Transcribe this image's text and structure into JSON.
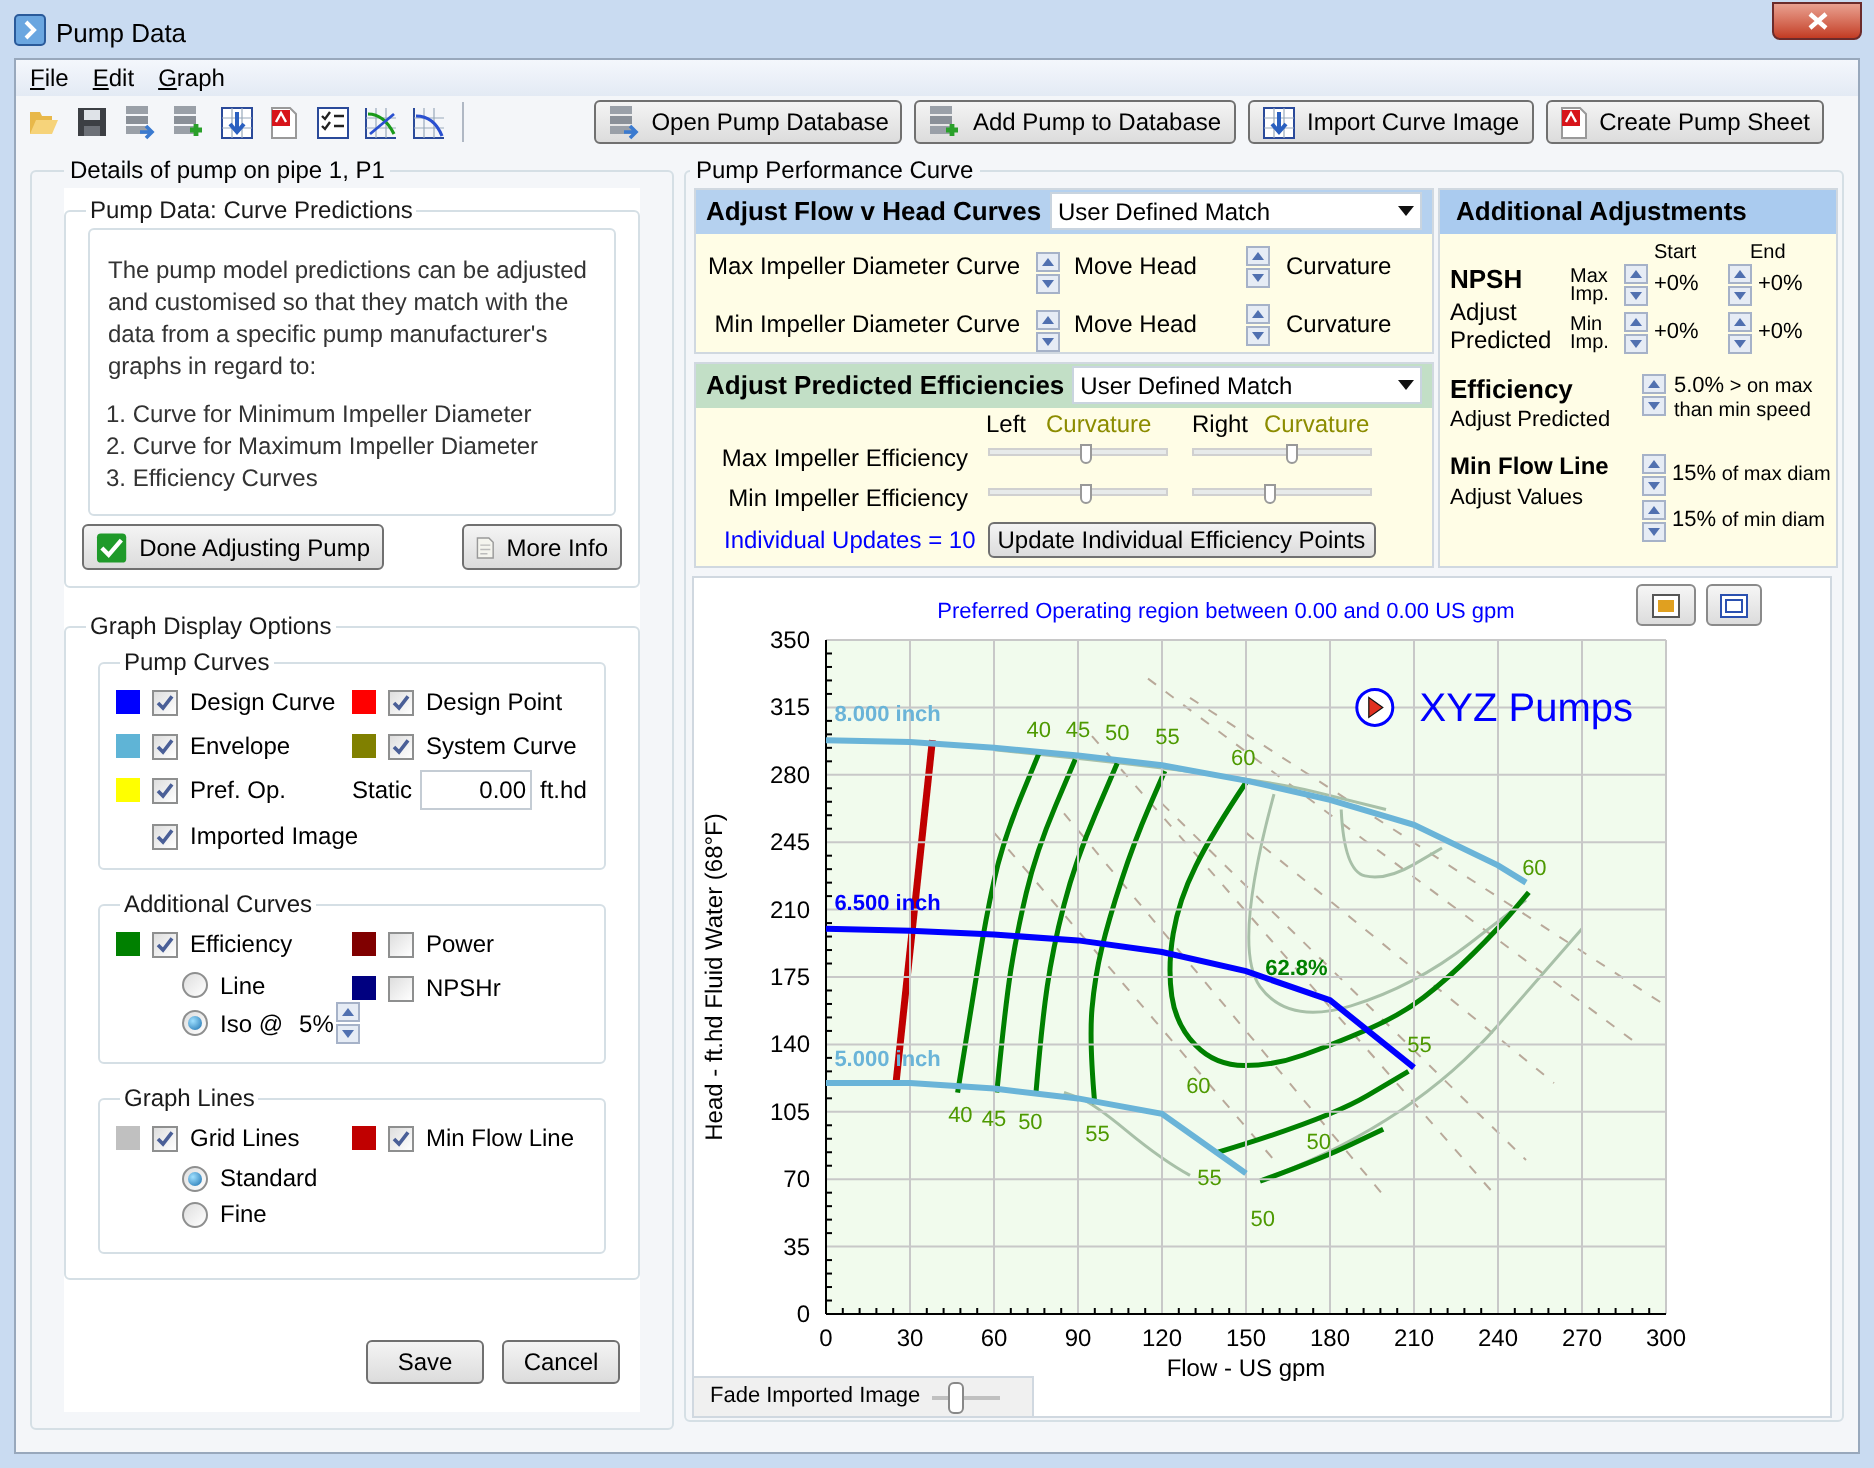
{
  "window": {
    "title": "Pump Data"
  },
  "menu": [
    {
      "label": "File"
    },
    {
      "label": "Edit"
    },
    {
      "label": "Graph"
    }
  ],
  "toolbar_buttons": [
    "Open Pump Database",
    "Add Pump to Database",
    "Import Curve Image",
    "Create Pump Sheet"
  ],
  "details": {
    "title": "Details of pump on pipe 1, P1",
    "predictions": {
      "title": "Pump Data: Curve Predictions",
      "intro": "The pump model predictions can be adjusted and customised so that they match with the data from a specific pump manufacturer's graphs in regard to:",
      "items": [
        "1. Curve for Minimum Impeller Diameter",
        "2. Curve for Maximum Impeller Diameter",
        "3. Efficiency Curves"
      ],
      "buttons": [
        "Done Adjusting Pump",
        "More Info"
      ]
    },
    "graph_options": {
      "title": "Graph Display Options",
      "pump_curves": {
        "title": "Pump Curves",
        "items": [
          {
            "label": "Design Curve",
            "color": "#0000ff",
            "checked": true
          },
          {
            "label": "Design Point",
            "color": "#ff0000",
            "checked": true
          },
          {
            "label": "Envelope",
            "color": "#5fb4d6",
            "checked": true
          },
          {
            "label": "System Curve",
            "color": "#808000",
            "checked": true
          },
          {
            "label": "Pref. Op.",
            "color": "#ffff00",
            "checked": true
          }
        ],
        "static": {
          "label": "Static",
          "value": "0.00",
          "unit": "ft.hd"
        },
        "imported_image": {
          "label": "Imported Image",
          "checked": true
        }
      },
      "additional_curves": {
        "title": "Additional Curves",
        "items": [
          {
            "label": "Efficiency",
            "color": "#008000",
            "checked": true
          },
          {
            "label": "Power",
            "color": "#800000",
            "checked": false
          },
          {
            "label": "NPSHr",
            "color": "#000080",
            "checked": false
          }
        ],
        "modes": [
          {
            "label": "Line",
            "selected": false
          },
          {
            "label": "Iso @",
            "selected": true
          }
        ],
        "iso_step": "5%"
      },
      "graph_lines": {
        "title": "Graph Lines",
        "items": [
          {
            "label": "Grid Lines",
            "color": "#c0c0c0",
            "checked": true
          },
          {
            "label": "Min Flow Line",
            "color": "#c00000",
            "checked": true
          }
        ],
        "styles": [
          {
            "label": "Standard",
            "selected": true
          },
          {
            "label": "Fine",
            "selected": false
          }
        ]
      }
    },
    "buttons": [
      "Save",
      "Cancel"
    ]
  },
  "performance": {
    "title": "Pump Performance Curve",
    "flow_head": {
      "title": "Adjust Flow v Head Curves",
      "mode": "User Defined Match",
      "rows": [
        {
          "label": "Max Impeller Diameter Curve",
          "controls": [
            "Move Head",
            "Curvature"
          ]
        },
        {
          "label": "Min Impeller Diameter Curve",
          "controls": [
            "Move Head",
            "Curvature"
          ]
        }
      ]
    },
    "efficiencies": {
      "title": "Adjust Predicted Efficiencies",
      "mode": "User Defined Match",
      "left_label": "Left",
      "left_curvature": "Curvature",
      "right_label": "Right",
      "right_curvature": "Curvature",
      "rows": [
        {
          "label": "Max Impeller Efficiency",
          "left": {
            "level": 0.54
          },
          "right": {
            "level": 0.56
          }
        },
        {
          "label": "Min Impeller Efficiency",
          "left": {
            "level": 0.54
          },
          "right": {
            "level": 0.43
          }
        }
      ],
      "updates": "Individual Updates = 10",
      "update_button": "Update Individual Efficiency Points"
    },
    "additional": {
      "title": "Additional Adjustments",
      "npsh": {
        "title": "NPSH",
        "subtitle": "Adjust Predicted",
        "start": "Start",
        "end": "End",
        "rows": [
          {
            "label": "Max Imp.",
            "start": "+0%",
            "end": "+0%"
          },
          {
            "label": "Min Imp.",
            "start": "+0%",
            "end": "+0%"
          }
        ]
      },
      "efficiency": {
        "title": "Efficiency",
        "subtitle": "Adjust Predicted",
        "value": "5.0%",
        "note": "> on max than min speed"
      },
      "min_flow": {
        "title": "Min Flow Line",
        "subtitle": "Adjust Values",
        "rows": [
          {
            "value": "15%",
            "note": "of max diam"
          },
          {
            "value": "15%",
            "note": "of min diam"
          }
        ]
      }
    },
    "graph": {
      "caption": "Preferred Operating region between 0.00 and 0.00 US gpm",
      "logo": "XYZ Pumps",
      "efficiency_labels": [
        "40",
        "45",
        "50",
        "55",
        "60",
        "60",
        "62.8%",
        "60",
        "55",
        "40",
        "45",
        "50",
        "55",
        "50",
        "55",
        "50"
      ],
      "chart_data": {
        "type": "line",
        "xlabel": "Flow - US gpm",
        "ylabel": "Head - ft.hd Fluid Water (68°F)",
        "x": [
          0,
          30,
          60,
          90,
          120,
          150,
          180,
          210,
          240,
          250
        ],
        "series": [
          {
            "name": "8.000 inch",
            "color": "#6ab4d8",
            "values": [
              298,
              297,
              294,
              290,
              285,
              277,
              267,
              254,
              233,
              224
            ]
          },
          {
            "name": "6.500 inch",
            "color": "#0000ff",
            "values": [
              200,
              199,
              197,
              194,
              188,
              178,
              163,
              128,
              null,
              null
            ]
          },
          {
            "name": "5.000 inch",
            "color": "#6ab4d8",
            "values": [
              120,
              120,
              117,
              112,
              104,
              73,
              null,
              null,
              null,
              null
            ]
          }
        ],
        "xlim": [
          0,
          300
        ],
        "ylim": [
          0,
          350
        ],
        "xticks": [
          0,
          30,
          60,
          90,
          120,
          150,
          180,
          210,
          240,
          270,
          300
        ],
        "yticks": [
          0,
          35,
          70,
          105,
          140,
          175,
          210,
          245,
          280,
          315,
          350
        ],
        "grid": true
      }
    },
    "fade": {
      "label": "Fade Imported Image",
      "level": 0.35
    }
  }
}
